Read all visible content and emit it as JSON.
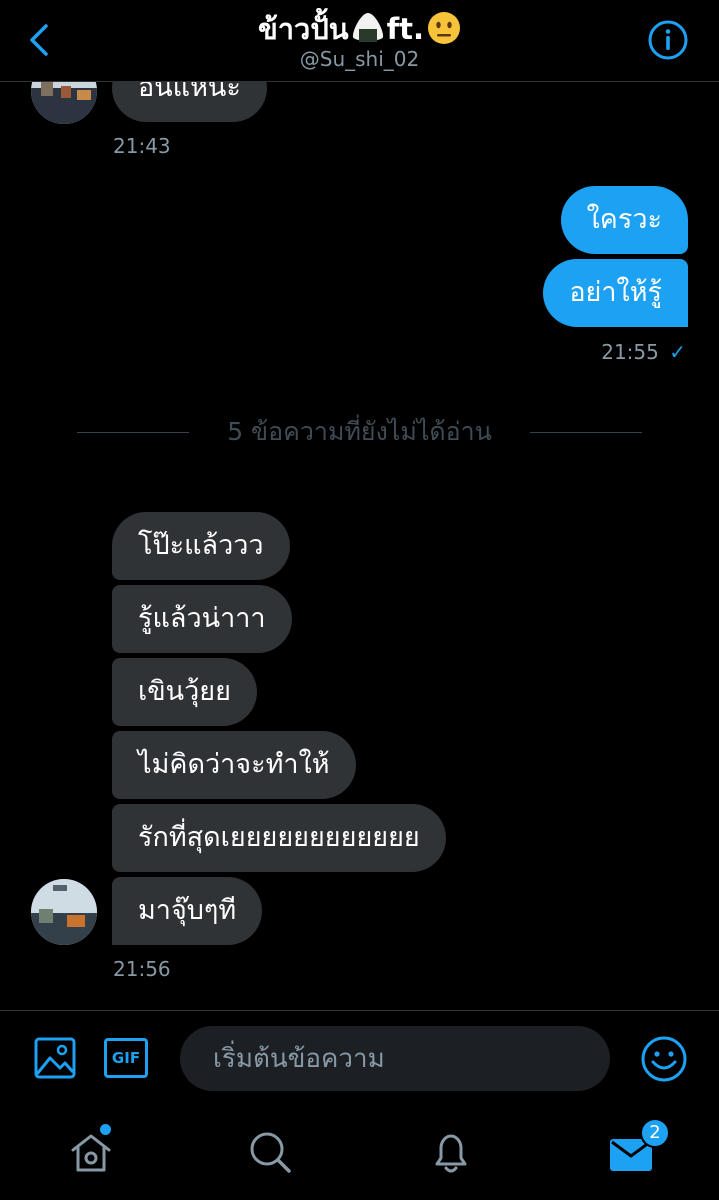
{
  "header": {
    "title": "ข้าวปั้น",
    "title_suffix": "ft.",
    "handle": "@Su_shi_02",
    "title_emojis": [
      "rice-ball",
      "neutral-face"
    ]
  },
  "conversation": {
    "top_messages": [
      {
        "text": "อันแหน่ะ",
        "direction": "in"
      }
    ],
    "top_time": "21:43",
    "sent_messages": [
      {
        "text": "ใครวะ"
      },
      {
        "text": "อย่าให้รู้"
      }
    ],
    "sent_time": "21:55",
    "sent_status": "✓",
    "unread_divider": "5 ข้อความที่ยังไม่ได้อ่าน",
    "received_messages": [
      {
        "text": "โป๊ะแล้ววว"
      },
      {
        "text": "รู้แล้วน่าาา"
      },
      {
        "text": "เขินวุ้ยย"
      },
      {
        "text": "ไม่คิดว่าจะทำให้"
      },
      {
        "text": "รักที่สุดเยยยยยยยยยยยย"
      },
      {
        "text": "มาจุ๊บๆที"
      }
    ],
    "received_time": "21:56"
  },
  "composer": {
    "placeholder": "เริ่มต้นข้อความ",
    "gif_label": "GIF"
  },
  "nav": {
    "messages_badge": "2"
  },
  "colors": {
    "accent": "#1da1f2",
    "bubble_in": "#2f3336",
    "background": "#000000",
    "muted": "#8899a6"
  }
}
